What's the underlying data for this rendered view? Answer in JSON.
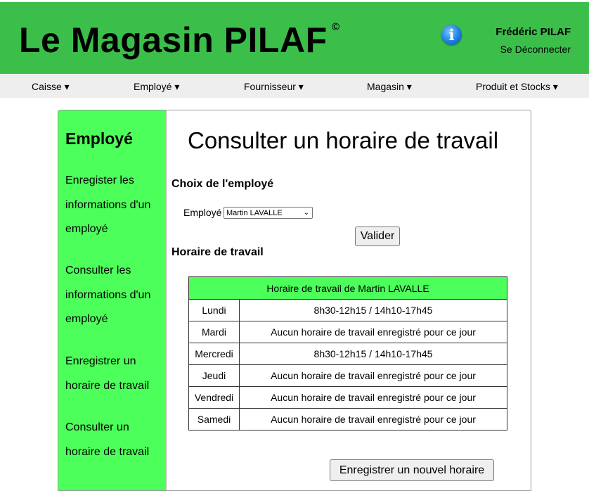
{
  "header": {
    "brand": "Le Magasin PILAF",
    "copyright": "©",
    "info_icon": "info-icon",
    "user_name": "Frédéric PILAF",
    "logout": "Se Déconnecter"
  },
  "nav": {
    "items": [
      {
        "label": "Caisse ▾"
      },
      {
        "label": "Employé ▾"
      },
      {
        "label": "Fournisseur ▾"
      },
      {
        "label": "Magasin ▾"
      },
      {
        "label": "Produit et Stocks ▾"
      }
    ]
  },
  "sidebar": {
    "title": "Employé",
    "links": [
      {
        "label": "Enregister les informations d'un employé"
      },
      {
        "label": "Consulter les informations d'un employé"
      },
      {
        "label": "Enregistrer un horaire de travail"
      },
      {
        "label": "Consulter un horaire de travail"
      }
    ]
  },
  "main": {
    "title": "Consulter un horaire de travail",
    "choice_heading": "Choix de l'employé",
    "employee_label": "Employé",
    "employee_selected": "Martin LAVALLE",
    "validate_button": "Valider",
    "schedule_heading": "Horaire de travail",
    "table_title": "Horaire de travail de Martin LAVALLE",
    "rows": [
      {
        "day": "Lundi",
        "hours": "8h30-12h15 / 14h10-17h45"
      },
      {
        "day": "Mardi",
        "hours": "Aucun horaire de travail enregistré pour ce jour"
      },
      {
        "day": "Mercredi",
        "hours": "8h30-12h15 / 14h10-17h45"
      },
      {
        "day": "Jeudi",
        "hours": "Aucun horaire de travail enregistré pour ce jour"
      },
      {
        "day": "Vendredi",
        "hours": "Aucun horaire de travail enregistré pour ce jour"
      },
      {
        "day": "Samedi",
        "hours": "Aucun horaire de travail enregistré pour ce jour"
      }
    ],
    "new_schedule_button": "Enregistrer un nouvel horaire"
  },
  "colors": {
    "header_green": "#3bbf4a",
    "sidebar_green": "#4cff5a",
    "nav_gray": "#eeeeee"
  }
}
